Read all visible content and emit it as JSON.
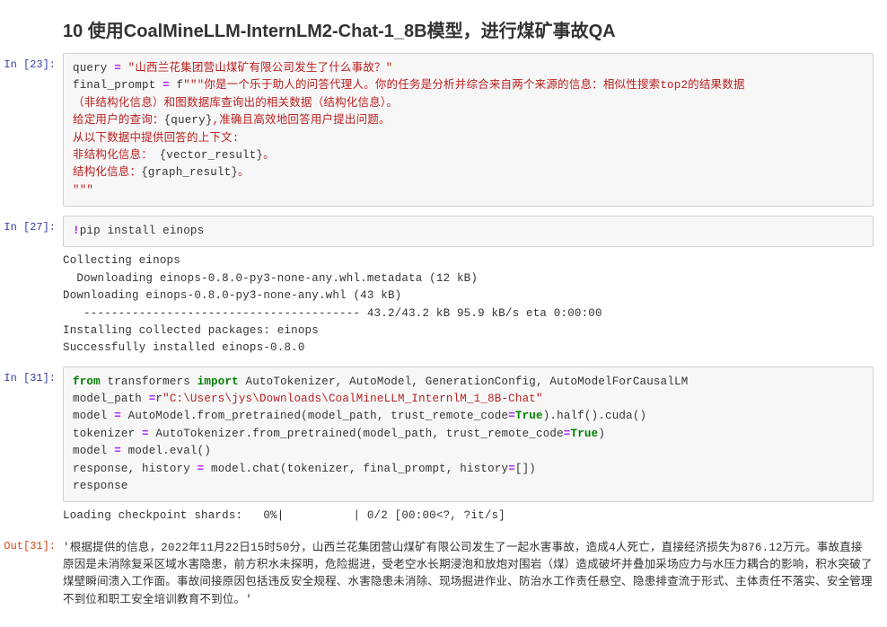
{
  "heading": "10 使用CoalMineLLM-InternLM2-Chat-1_8B模型，进行煤矿事故QA",
  "prompts": {
    "in23": "In [23]:",
    "in27": "In [27]:",
    "in31": "In [31]:",
    "out31": "Out[31]:"
  },
  "cell23": {
    "l1a": "query ",
    "l1op": "=",
    "l1b": " ",
    "l1str": "\"山西兰花集团营山煤矿有限公司发生了什么事故？\"",
    "l2a": "final_prompt ",
    "l2op": "=",
    "l2b": " f",
    "l2str1": "\"\"\"你是一个乐于助人的问答代理人。你的任务是分析并综合来自两个来源的信息：相似性搜索top2的结果数据\n（非结构化信息）和图数据库查询出的相关数据（结构化信息）。\n给定用户的查询：",
    "l2f1a": "{query}",
    "l2str2": ",准确且高效地回答用户提出问题。\n从以下数据中提供回答的上下文:\n非结构化信息： ",
    "l2f2a": "{vector_result}",
    "l2str3": "。\n结构化信息：",
    "l2f3a": "{graph_result}",
    "l2str4": "。\n\"\"\""
  },
  "cell27": {
    "l1op": "!",
    "l1a": "pip install einops"
  },
  "out27": "Collecting einops\n  Downloading einops-0.8.0-py3-none-any.whl.metadata (12 kB)\nDownloading einops-0.8.0-py3-none-any.whl (43 kB)\n   ---------------------------------------- 43.2/43.2 kB 95.9 kB/s eta 0:00:00\nInstalling collected packages: einops\nSuccessfully installed einops-0.8.0",
  "cell31": {
    "l1kw": "from",
    "l1a": " transformers ",
    "l1kw2": "import",
    "l1b": " AutoTokenizer, AutoModel, GenerationConfig, AutoModelForCausalLM",
    "l2a": "model_path ",
    "l2op": "=",
    "l2b": "r",
    "l2str": "\"C:\\Users\\jys\\Downloads\\CoalMineLLM_InternlM_1_8B-Chat\"",
    "l3a": "model ",
    "l3op": "=",
    "l3b": " AutoModel.from_pretrained(model_path, trust_remote_code",
    "l3op2": "=",
    "l3kw": "True",
    "l3c": ").half().cuda()",
    "l4a": "tokenizer ",
    "l4op": "=",
    "l4b": " AutoTokenizer.from_pretrained(model_path, trust_remote_code",
    "l4op2": "=",
    "l4kw": "True",
    "l4c": ")",
    "l5a": "model ",
    "l5op": "=",
    "l5b": " model.eval()",
    "l6a": "response, history ",
    "l6op": "=",
    "l6b": " model.chat(tokenizer, final_prompt, history",
    "l6op2": "=",
    "l6c": "[])",
    "l7a": "response"
  },
  "out31a": "Loading checkpoint shards:   0%|          | 0/2 [00:00<?, ?it/s]",
  "out31b": "'根据提供的信息，2022年11月22日15时50分，山西兰花集团营山煤矿有限公司发生了一起水害事故，造成4人死亡，直接经济损失为876.12万元。事故直接原因是未消除复采区域水害隐患，前方积水未探明，危险掘进，受老空水长期浸泡和放炮对围岩（煤）造成破坏并叠加采场应力与水压力耦合的影响，积水突破了煤壁瞬间溃入工作面。事故间接原因包括违反安全规程、水害隐患未消除、现场掘进作业、防治水工作责任悬空、隐患排查流于形式、主体责任不落实、安全管理不到位和职工安全培训教育不到位。'"
}
